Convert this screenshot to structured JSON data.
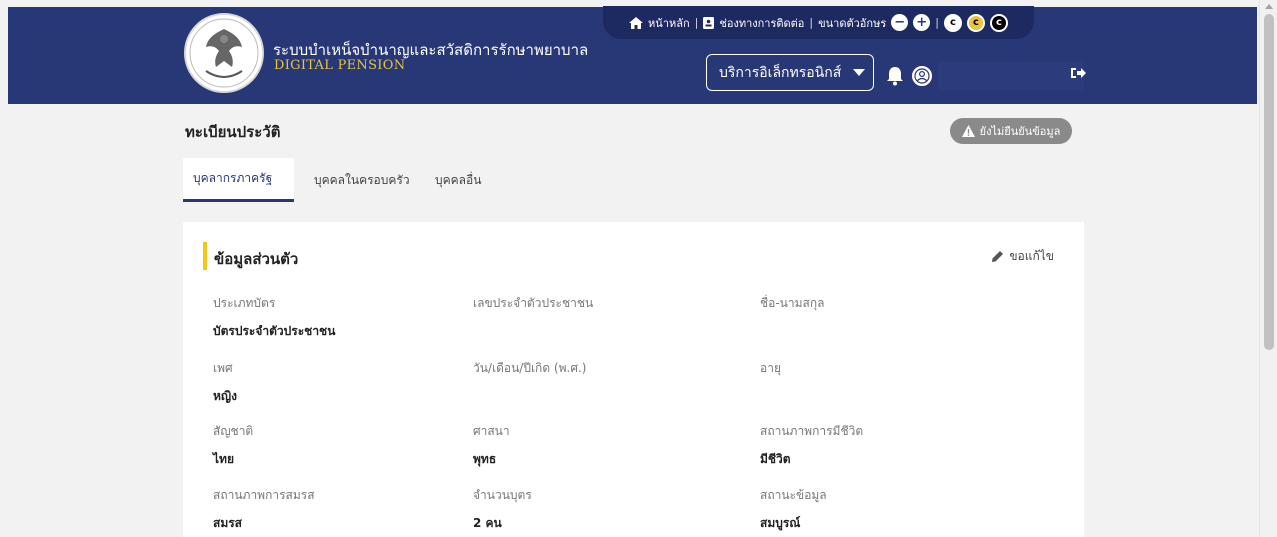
{
  "header": {
    "brand_th": "ระบบบำเหน็จบำนาญและสวัสดิการรักษาพยาบาล",
    "brand_en": "DIGITAL PENSION",
    "util": {
      "home": "หน้าหลัก",
      "contact": "ช่องทางการติดต่อ",
      "font_size": "ขนาดตัวอักษร",
      "contrast_labels": [
        "c",
        "c",
        "c"
      ]
    },
    "service_select": "บริการอิเล็กทรอนิกส์",
    "icons": [
      "home-icon",
      "contact-card-icon",
      "font-minus-icon",
      "font-plus-icon",
      "bell-icon",
      "user-icon",
      "sign-out-icon"
    ]
  },
  "page": {
    "title": "ทะเบียนประวัติ",
    "status_badge": "ยังไม่ยืนยันข้อมูล"
  },
  "tabs": [
    {
      "label": "บุคลากรภาครัฐ",
      "active": true
    },
    {
      "label": "บุคคลในครอบครัว",
      "active": false
    },
    {
      "label": "บุคคลอื่น",
      "active": false
    }
  ],
  "card": {
    "title": "ข้อมูลส่วนตัว",
    "edit_label": "ขอแก้ไข",
    "fields": [
      {
        "label": "ประเภทบัตร",
        "value": "บัตรประจำตัวประชาชน"
      },
      {
        "label": "เลขประจำตัวประชาชน",
        "value": ""
      },
      {
        "label": "ชื่อ-นามสกุล",
        "value": ""
      },
      {
        "label": "เพศ",
        "value": "หญิง"
      },
      {
        "label": "วัน/เดือน/ปีเกิด (พ.ศ.)",
        "value": ""
      },
      {
        "label": "อายุ",
        "value": ""
      },
      {
        "label": "สัญชาติ",
        "value": "ไทย"
      },
      {
        "label": "ศาสนา",
        "value": "พุทธ"
      },
      {
        "label": "สถานภาพการมีชีวิต",
        "value": "มีชีวิต"
      },
      {
        "label": "สถานภาพการสมรส",
        "value": "สมรส"
      },
      {
        "label": "จำนวนบุตร",
        "value": "2 คน"
      },
      {
        "label": "สถานะข้อมูล",
        "value": "สมบูรณ์"
      }
    ]
  },
  "colors": {
    "navy": "#283775",
    "gold": "#e9c43c",
    "accent_bar": "#f5c518",
    "badge_gray": "#8a8a8a"
  }
}
